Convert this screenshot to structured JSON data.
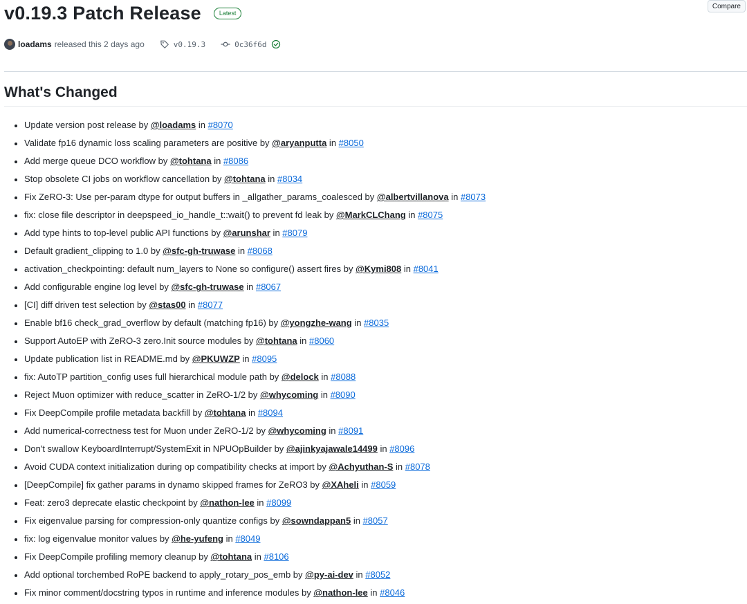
{
  "release": {
    "title": "v0.19.3 Patch Release",
    "badge": "Latest",
    "compare_label": "Compare",
    "author": "loadams",
    "released_text": "released this 2 days ago",
    "tag": "v0.19.3",
    "commit": "0c36f6d"
  },
  "section_title": "What's Changed",
  "changes": [
    {
      "text": "Update version post release by ",
      "user": "@loadams",
      "pr": "#8070"
    },
    {
      "text": "Validate fp16 dynamic loss scaling parameters are positive by ",
      "user": "@aryanputta",
      "pr": "#8050"
    },
    {
      "text": "Add merge queue DCO workflow by ",
      "user": "@tohtana",
      "pr": "#8086"
    },
    {
      "text": "Stop obsolete CI jobs on workflow cancellation by ",
      "user": "@tohtana",
      "pr": "#8034"
    },
    {
      "text": "Fix ZeRO-3: Use per-param dtype for output buffers in _allgather_params_coalesced by ",
      "user": "@albertvillanova",
      "pr": "#8073"
    },
    {
      "text": "fix: close file descriptor in deepspeed_io_handle_t::wait() to prevent fd leak by ",
      "user": "@MarkCLChang",
      "pr": "#8075"
    },
    {
      "text": "Add type hints to top-level public API functions by ",
      "user": "@arunshar",
      "pr": "#8079"
    },
    {
      "text": "Default gradient_clipping to 1.0 by ",
      "user": "@sfc-gh-truwase",
      "pr": "#8068"
    },
    {
      "text": "activation_checkpointing: default num_layers to None so configure() assert fires by ",
      "user": "@Kymi808",
      "pr": "#8041"
    },
    {
      "text": "Add configurable engine log level by ",
      "user": "@sfc-gh-truwase",
      "pr": "#8067"
    },
    {
      "text": "[CI] diff driven test selection by ",
      "user": "@stas00",
      "pr": "#8077"
    },
    {
      "text": "Enable bf16 check_grad_overflow by default (matching fp16) by ",
      "user": "@yongzhe-wang",
      "pr": "#8035"
    },
    {
      "text": "Support AutoEP with ZeRO-3 zero.Init source modules by ",
      "user": "@tohtana",
      "pr": "#8060"
    },
    {
      "text": "Update publication list in README.md by ",
      "user": "@PKUWZP",
      "pr": "#8095"
    },
    {
      "text": "fix: AutoTP partition_config uses full hierarchical module path by ",
      "user": "@delock",
      "pr": "#8088"
    },
    {
      "text": "Reject Muon optimizer with reduce_scatter in ZeRO-1/2 by ",
      "user": "@whycoming",
      "pr": "#8090"
    },
    {
      "text": "Fix DeepCompile profile metadata backfill by ",
      "user": "@tohtana",
      "pr": "#8094"
    },
    {
      "text": "Add numerical-correctness test for Muon under ZeRO-1/2 by ",
      "user": "@whycoming",
      "pr": "#8091"
    },
    {
      "text": "Don't swallow KeyboardInterrupt/SystemExit in NPUOpBuilder by ",
      "user": "@ajinkyajawale14499",
      "pr": "#8096"
    },
    {
      "text": "Avoid CUDA context initialization during op compatibility checks at import by ",
      "user": "@Achyuthan-S",
      "pr": "#8078"
    },
    {
      "text": "[DeepCompile] fix gather params in dynamo skipped frames for ZeRO3 by ",
      "user": "@XAheli",
      "pr": "#8059"
    },
    {
      "text": "Feat: zero3 deprecate elastic checkpoint by ",
      "user": "@nathon-lee",
      "pr": "#8099"
    },
    {
      "text": "Fix eigenvalue parsing for compression-only quantize configs by ",
      "user": "@sowndappan5",
      "pr": "#8057"
    },
    {
      "text": "fix: log eigenvalue monitor values by ",
      "user": "@he-yufeng",
      "pr": "#8049"
    },
    {
      "text": "Fix DeepCompile profiling memory cleanup by ",
      "user": "@tohtana",
      "pr": "#8106"
    },
    {
      "text": "Add optional torchembed RoPE backend to apply_rotary_pos_emb by ",
      "user": "@py-ai-dev",
      "pr": "#8052"
    },
    {
      "text": "Fix minor comment/docstring typos in runtime and inference modules by ",
      "user": "@nathon-lee",
      "pr": "#8046"
    }
  ],
  "connector_in": "in"
}
